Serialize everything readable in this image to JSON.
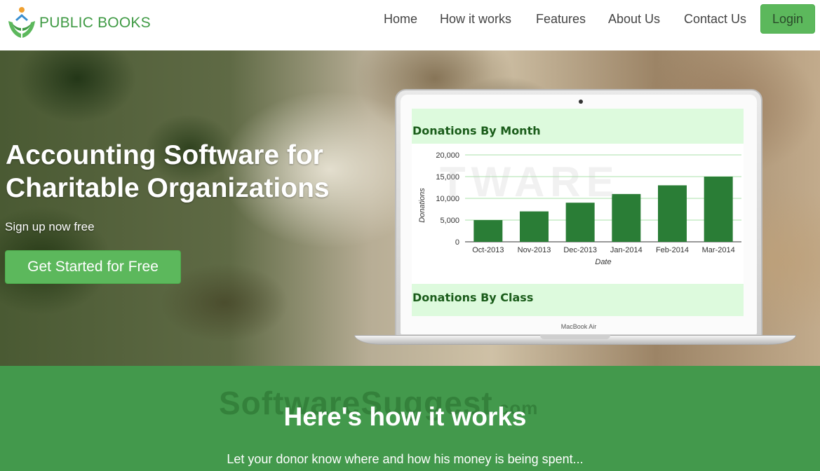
{
  "brand": {
    "name": "PUBLIC BOOKS"
  },
  "nav": {
    "items": [
      {
        "label": "Home"
      },
      {
        "label": "How it works"
      },
      {
        "label": "Features"
      },
      {
        "label": "About Us"
      },
      {
        "label": "Contact Us"
      }
    ],
    "login_label": "Login"
  },
  "hero": {
    "title_line1": "Accounting Software for",
    "title_line2": "Charitable Organizations",
    "subtitle": "Sign up now free",
    "cta_label": "Get Started for Free"
  },
  "laptop": {
    "label": "MacBook Air",
    "panel1_title": "Donations By Month",
    "panel2_title": "Donations By Class"
  },
  "chart_data": {
    "type": "bar",
    "title": "Donations By Month",
    "categories": [
      "Oct-2013",
      "Nov-2013",
      "Dec-2013",
      "Jan-2014",
      "Feb-2014",
      "Mar-2014"
    ],
    "values": [
      5000,
      7000,
      9000,
      11000,
      13000,
      15000
    ],
    "xlabel": "Date",
    "ylabel": "Donations",
    "ylim": [
      0,
      20000
    ],
    "yticks": [
      "0",
      "5,000",
      "10,000",
      "15,000",
      "20,000"
    ],
    "grid": true,
    "bar_color": "#2a7d36",
    "grid_color": "#a8e0a8"
  },
  "watermarks": {
    "hero": "TWARE",
    "how": "SoftwareSuggest",
    "how_suffix": ".com"
  },
  "how": {
    "title": "Here's how it works",
    "subtitle": "Let your donor know where and how his money is being spent..."
  },
  "colors": {
    "brand_green": "#3f9a44",
    "button_green": "#5cb85c",
    "section_green": "#43994c",
    "panel_bg": "#ddfadd"
  }
}
